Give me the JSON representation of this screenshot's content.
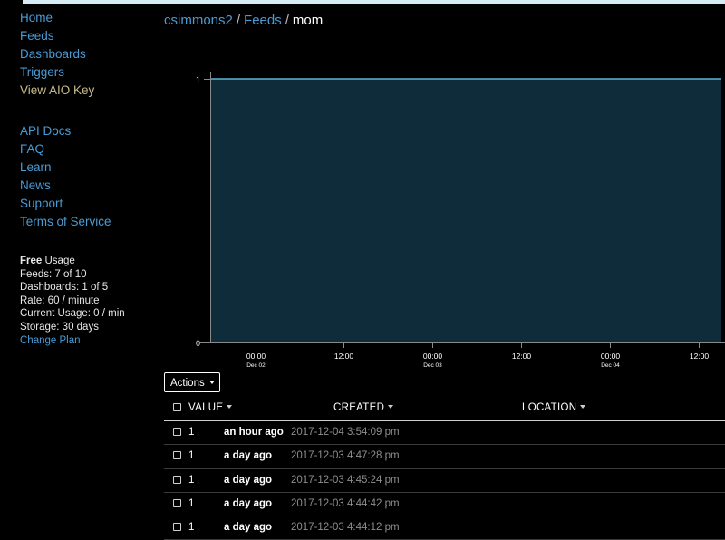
{
  "sidebar": {
    "nav_primary": [
      {
        "label": "Home",
        "name": "sidebar-item-home"
      },
      {
        "label": "Feeds",
        "name": "sidebar-item-feeds"
      },
      {
        "label": "Dashboards",
        "name": "sidebar-item-dashboards"
      },
      {
        "label": "Triggers",
        "name": "sidebar-item-triggers"
      },
      {
        "label": "View AIO Key",
        "name": "sidebar-item-view-aio-key"
      }
    ],
    "nav_secondary": [
      {
        "label": "API Docs",
        "name": "sidebar-item-api-docs"
      },
      {
        "label": "FAQ",
        "name": "sidebar-item-faq"
      },
      {
        "label": "Learn",
        "name": "sidebar-item-learn"
      },
      {
        "label": "News",
        "name": "sidebar-item-news"
      },
      {
        "label": "Support",
        "name": "sidebar-item-support"
      },
      {
        "label": "Terms of Service",
        "name": "sidebar-item-terms-of-service"
      }
    ],
    "usage": {
      "plan_name": "Free",
      "plan_suffix": " Usage",
      "feeds": "Feeds: 7 of 10",
      "dashboards": "Dashboards: 1 of 5",
      "rate": "Rate: 60 / minute",
      "current_usage": "Current Usage: 0 / min",
      "storage": "Storage: 30 days",
      "change_plan": "Change Plan"
    }
  },
  "breadcrumb": {
    "user": "csimmons2",
    "sep1": "/",
    "section": "Feeds",
    "sep2": "/",
    "feed": "mom"
  },
  "toolbar": {
    "actions_label": "Actions"
  },
  "table": {
    "headers": {
      "value": "VALUE",
      "created": "CREATED",
      "location": "LOCATION"
    },
    "rows": [
      {
        "value": "1",
        "relative": "an hour ago",
        "absolute": "2017-12-04 3:54:09 pm"
      },
      {
        "value": "1",
        "relative": "a day ago",
        "absolute": "2017-12-03 4:47:28 pm"
      },
      {
        "value": "1",
        "relative": "a day ago",
        "absolute": "2017-12-03 4:45:24 pm"
      },
      {
        "value": "1",
        "relative": "a day ago",
        "absolute": "2017-12-03 4:44:42 pm"
      },
      {
        "value": "1",
        "relative": "a day ago",
        "absolute": "2017-12-03 4:44:12 pm"
      }
    ]
  },
  "chart_data": {
    "type": "area",
    "title": "",
    "xlabel": "",
    "ylabel": "",
    "ylim": [
      0,
      1
    ],
    "ytick_labels": [
      "0",
      "1"
    ],
    "ytick_values": [
      0,
      1
    ],
    "grid": false,
    "legend": false,
    "line_color": "#5fb3d4",
    "fill_color": "#0e2c3a",
    "axis_color": "#8a8a8a",
    "xtick_labels": [
      "00:00",
      "12:00",
      "00:00",
      "12:00",
      "00:00",
      "12:00"
    ],
    "xtick_sublabels": [
      "Dec 02",
      "",
      "Dec 03",
      "",
      "Dec 04",
      ""
    ],
    "series": [
      {
        "name": "mom",
        "x": [
          "Dec 02 00:00",
          "Dec 02 12:00",
          "Dec 03 00:00",
          "Dec 03 12:00",
          "Dec 04 00:00",
          "Dec 04 12:00"
        ],
        "values": [
          1,
          1,
          1,
          1,
          1,
          1
        ]
      }
    ]
  }
}
